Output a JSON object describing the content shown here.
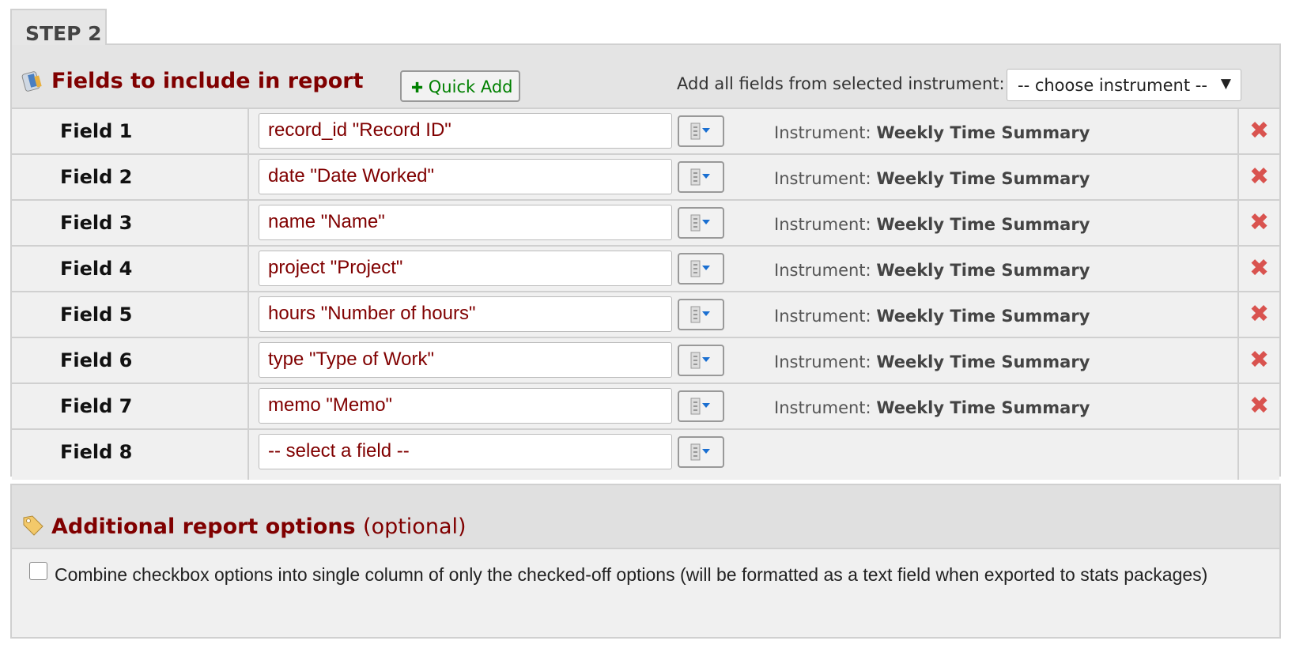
{
  "step_tab": "STEP 2",
  "fields_section": {
    "title": "Fields to include in report",
    "quick_add": "Quick Add",
    "add_all_label": "Add all fields from selected instrument:",
    "instrument_select": "-- choose instrument --",
    "instrument_prefix": "Instrument:",
    "rows": [
      {
        "label": "Field 1",
        "value": "record_id \"Record ID\"",
        "instrument": "Weekly Time Summary"
      },
      {
        "label": "Field 2",
        "value": "date \"Date Worked\"",
        "instrument": "Weekly Time Summary"
      },
      {
        "label": "Field 3",
        "value": "name \"Name\"",
        "instrument": "Weekly Time Summary"
      },
      {
        "label": "Field 4",
        "value": "project \"Project\"",
        "instrument": "Weekly Time Summary"
      },
      {
        "label": "Field 5",
        "value": "hours \"Number of hours\"",
        "instrument": "Weekly Time Summary"
      },
      {
        "label": "Field 6",
        "value": "type \"Type of Work\"",
        "instrument": "Weekly Time Summary"
      },
      {
        "label": "Field 7",
        "value": "memo \"Memo\"",
        "instrument": "Weekly Time Summary"
      },
      {
        "label": "Field 8",
        "value": "-- select a field --",
        "instrument": null
      }
    ]
  },
  "options_section": {
    "title": "Additional report options",
    "optional": "(optional)",
    "combine_checkbox": {
      "label": "Combine checkbox options into single column of only the checked-off options (will be formatted as a text field when exported to stats packages)",
      "checked": false
    }
  },
  "colors": {
    "title": "#800000",
    "quick_add": "#008000",
    "delete": "#d9534f",
    "picker_arrow": "#1a6fd1"
  }
}
